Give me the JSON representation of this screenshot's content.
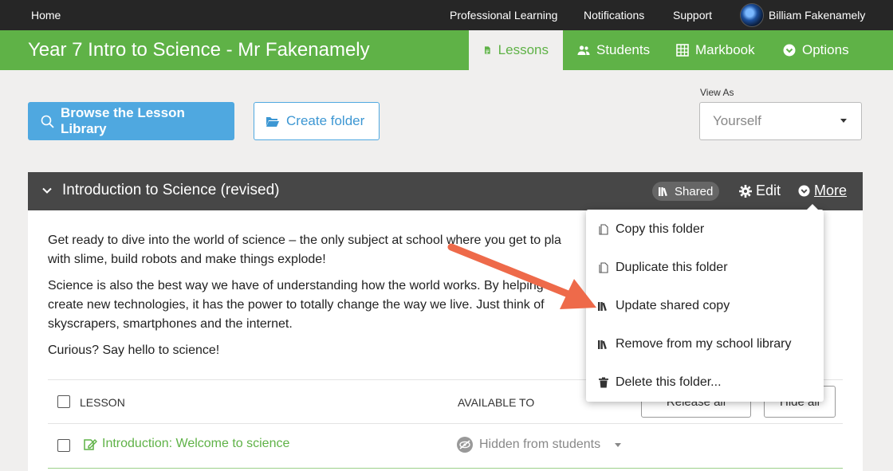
{
  "topnav": {
    "home": "Home",
    "items": [
      "Professional Learning",
      "Notifications",
      "Support"
    ],
    "user_name": "Billiam Fakenamely"
  },
  "classbar": {
    "title": "Year 7 Intro to Science - Mr Fakenamely",
    "tabs": [
      {
        "label": "Lessons",
        "icon": "document-icon",
        "active": true
      },
      {
        "label": "Students",
        "icon": "users-icon"
      },
      {
        "label": "Markbook",
        "icon": "grid-icon"
      },
      {
        "label": "Options",
        "icon": "chevron-circle-icon"
      }
    ]
  },
  "actions": {
    "browse_label": "Browse the Lesson Library",
    "create_folder_label": "Create folder",
    "view_as_label": "View As",
    "view_as_value": "Yourself"
  },
  "folder": {
    "title": "Introduction to Science (revised)",
    "shared_badge": "Shared",
    "edit_label": "Edit",
    "more_label": "More",
    "description": [
      "Get ready to dive into the world of science – the only subject at school where you get to pla",
      "with slime, build robots and make things explode!",
      "Science is also the best way we have of understanding how the world works. By helping",
      "create new technologies, it has the power to totally change the way we live. Just think of",
      "skyscrapers, smartphones and the internet.",
      "Curious? Say hello to science!"
    ],
    "table": {
      "col_lesson": "LESSON",
      "col_available": "AVAILABLE TO",
      "release_all": "Release all",
      "hide_all": "Hide all"
    },
    "lessons": [
      {
        "title": "Introduction: Welcome to science",
        "availability": "Hidden from students"
      }
    ]
  },
  "more_menu": {
    "items": [
      {
        "label": "Copy this folder",
        "icon": "copy-icon"
      },
      {
        "label": "Duplicate this folder",
        "icon": "copy-icon"
      },
      {
        "label": "Update shared copy",
        "icon": "library-icon"
      },
      {
        "label": "Remove from my school library",
        "icon": "library-icon"
      },
      {
        "label": "Delete this folder...",
        "icon": "trash-icon"
      }
    ]
  },
  "colors": {
    "brand_green": "#5fb247",
    "primary_blue": "#4fa8e0",
    "annotation_arrow": "#ee6a4a"
  }
}
